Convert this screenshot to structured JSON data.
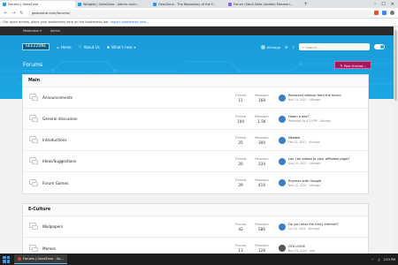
{
  "browser": {
    "tabs": [
      {
        "label": "Forums | GeezZone",
        "active": true
      },
      {
        "label": "Widgets | GeezZone - Admin contr..."
      },
      {
        "label": "GeezZone - The Repository of the F..."
      },
      {
        "label": "Forum (Stack Beta Update) Mesmeri..."
      }
    ],
    "new_tab": "+",
    "url": "geezzone.com/forums/",
    "bookmark_notice": "For quick access, place your bookmarks here on the bookmarks bar.",
    "bookmark_link": "Import bookmarks now..."
  },
  "staffbar": {
    "items": [
      "Moderator ▾",
      "Admin"
    ]
  },
  "header": {
    "logo": "GEEZZONE",
    "nav": [
      {
        "label": "Home",
        "icon": "home-icon"
      },
      {
        "label": "About Us",
        "icon": "info-icon"
      },
      {
        "label": "What's new",
        "icon": "bulb-icon"
      }
    ],
    "username": "Akinaga",
    "search_placeholder": "Search..."
  },
  "page": {
    "title": "Forums",
    "post_button": "✎ Post thread..."
  },
  "stat_labels": {
    "threads": "Threads",
    "messages": "Messages"
  },
  "categories": [
    {
      "name": "Main",
      "forums": [
        {
          "name": "Announcements",
          "threads": "11",
          "messages": "168",
          "latest_title": "Removed sidebar from the forum",
          "latest_meta": "Nov 13, 2021 · Akinaga",
          "avatar_color": "#3d7fc1"
        },
        {
          "name": "General discussion",
          "threads": "104",
          "messages": "1.5K",
          "latest_title": "Hoom a day?",
          "latest_meta": "Yesterday at 4:23 PM · Akinaga",
          "avatar_color": "#3d7fc1"
        },
        {
          "name": "Introductions",
          "threads": "25",
          "messages": "300",
          "latest_title": "Newbie",
          "latest_meta": "Feb 22, 2021 · Akinaga",
          "avatar_color": "#3d7fc1"
        },
        {
          "name": "Ideas/Suggestions",
          "threads": "20",
          "messages": "234",
          "latest_title": "can I be added to your affiliates page?",
          "latest_meta": "Aug 20, 2021 · Akinaga",
          "avatar_color": "#3d7fc1"
        },
        {
          "name": "Forum Games",
          "threads": "29",
          "messages": "416",
          "latest_title": "Rhymes with Google",
          "latest_meta": "Nov 12, 2021 · Akinaga",
          "avatar_color": "#3d7fc1"
        }
      ]
    },
    {
      "name": "E-Culture",
      "forums": [
        {
          "name": "Wallpapers",
          "threads": "42",
          "messages": "586",
          "latest_title": "Do you miss the Early Internet?",
          "latest_meta": "Jun 24, 2021 · Akinaga",
          "avatar_color": "#3d7fc1"
        },
        {
          "name": "Memes",
          "threads": "13",
          "messages": "128",
          "latest_title": "GTA LOGIC",
          "latest_meta": "Nov 23, 2020 · Arik",
          "avatar_color": "#555555"
        }
      ]
    }
  ],
  "taskbar": {
    "task_label": "Forums | GeezZone - Go...",
    "time": "2:11 PM"
  }
}
